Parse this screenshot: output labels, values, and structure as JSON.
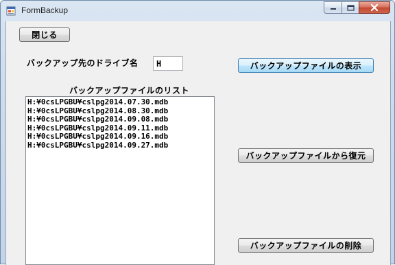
{
  "window": {
    "title": "FormBackup",
    "controls": {
      "minimize_icon": "minimize-icon",
      "maximize_icon": "maximize-icon",
      "close_icon": "close-icon"
    }
  },
  "form": {
    "close_button": "閉じる",
    "drive_label": "バックアップ先のドライブ名",
    "drive_value": "H",
    "list_label": "バックアップファイルのリスト",
    "files": [
      "H:¥0csLPGBU¥cslpg2014.07.30.mdb",
      "H:¥0csLPGBU¥cslpg2014.08.30.mdb",
      "H:¥0csLPGBU¥cslpg2014.09.08.mdb",
      "H:¥0csLPGBU¥cslpg2014.09.11.mdb",
      "H:¥0csLPGBU¥cslpg2014.09.16.mdb",
      "H:¥0csLPGBU¥cslpg2014.09.27.mdb"
    ],
    "show_button": "バックアップファイルの表示",
    "restore_button": "バックアップファイルから復元",
    "delete_button": "バックアップファイルの削除"
  },
  "colors": {
    "title_bg": "#cfdcec",
    "client_bg": "#f0f0f0",
    "close_button_red": "#c14a32",
    "focus_border": "#3c7fb1"
  }
}
